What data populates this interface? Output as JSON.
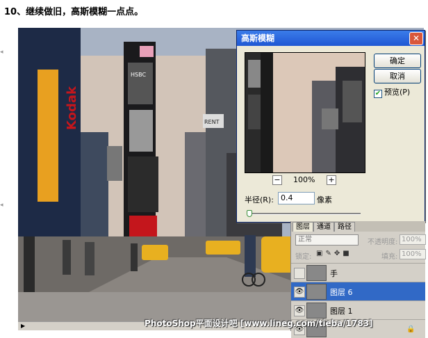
{
  "caption": "10、继续做旧，高斯模糊一点点。",
  "dialog": {
    "title": "高斯模糊",
    "ok_label": "确定",
    "cancel_label": "取消",
    "preview_label": "预览(P)",
    "preview_checked": true,
    "zoom_minus": "−",
    "zoom_value": "100%",
    "zoom_plus": "+",
    "radius_label": "半径(R):",
    "radius_value": "0.4",
    "radius_unit": "像素",
    "close_icon": "close-icon"
  },
  "layers_panel": {
    "tabs": [
      "图层",
      "通道",
      "路径"
    ],
    "blend_mode": "正常",
    "opacity_label": "不透明度:",
    "opacity_value": "100%",
    "lock_label": "锁定:",
    "fill_label": "填充:",
    "fill_value": "100%",
    "layers": [
      {
        "name": "手",
        "visible": false,
        "selected": false
      },
      {
        "name": "图层 6",
        "visible": true,
        "selected": true
      },
      {
        "name": "图层 1",
        "visible": true,
        "selected": false
      }
    ]
  },
  "canvas": {
    "signs": [
      "Kodak",
      "HSBC",
      "RENT"
    ]
  },
  "watermark": "PhotoShop平面设计吧 [www.lineg.com/tieba/1783]"
}
